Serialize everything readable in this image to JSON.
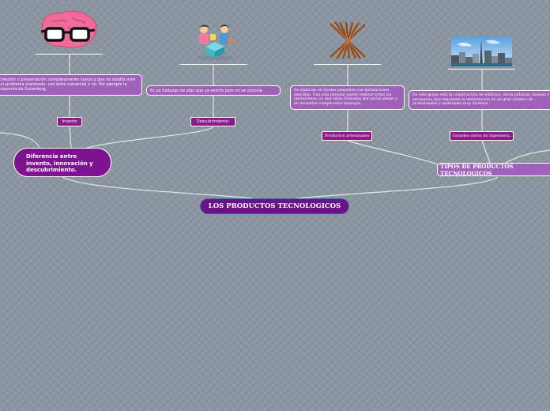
{
  "root": {
    "title": "LOS PRODUCTOS TECNOLOGICOS"
  },
  "hub_left": {
    "title": "Diferencia entre invento, innovación y descubrimiento."
  },
  "hub_right": {
    "title": "TIPOS DE PRODUCTOS TECNOLOGICOS"
  },
  "invento": {
    "label": "Invento",
    "description": "creación o presentación completamente nueva y que no existía ante un problema planteado, con éxito comercial o no. Por ejemplo la imprenta de Gutenberg.",
    "image": "brain-with-glasses"
  },
  "descubrimiento": {
    "label": "Descubrimiento:",
    "description": "Es un hallazgo de algo que ya existía pero no se conocía.",
    "image": "people-discovering"
  },
  "artesanales": {
    "label": "Productos artesanales",
    "description": "Se elaboran en locales pequeños con instalaciones sencillas. Una sola persona puede realizar todas las operaciones, ya que están formadas por pocas piezas y no necesitan complicados montajes.",
    "image": "twisted-wooden-sculpture"
  },
  "ingenieria": {
    "label": "Grandes obras de ingeniería.",
    "description": "En este grupo está la construcción de edificios, obras públicas, buques y aeronaves, que requieren la intervención de un gran número de profesionales y materiales muy diversos.",
    "image": "city-skyline-tower"
  }
}
